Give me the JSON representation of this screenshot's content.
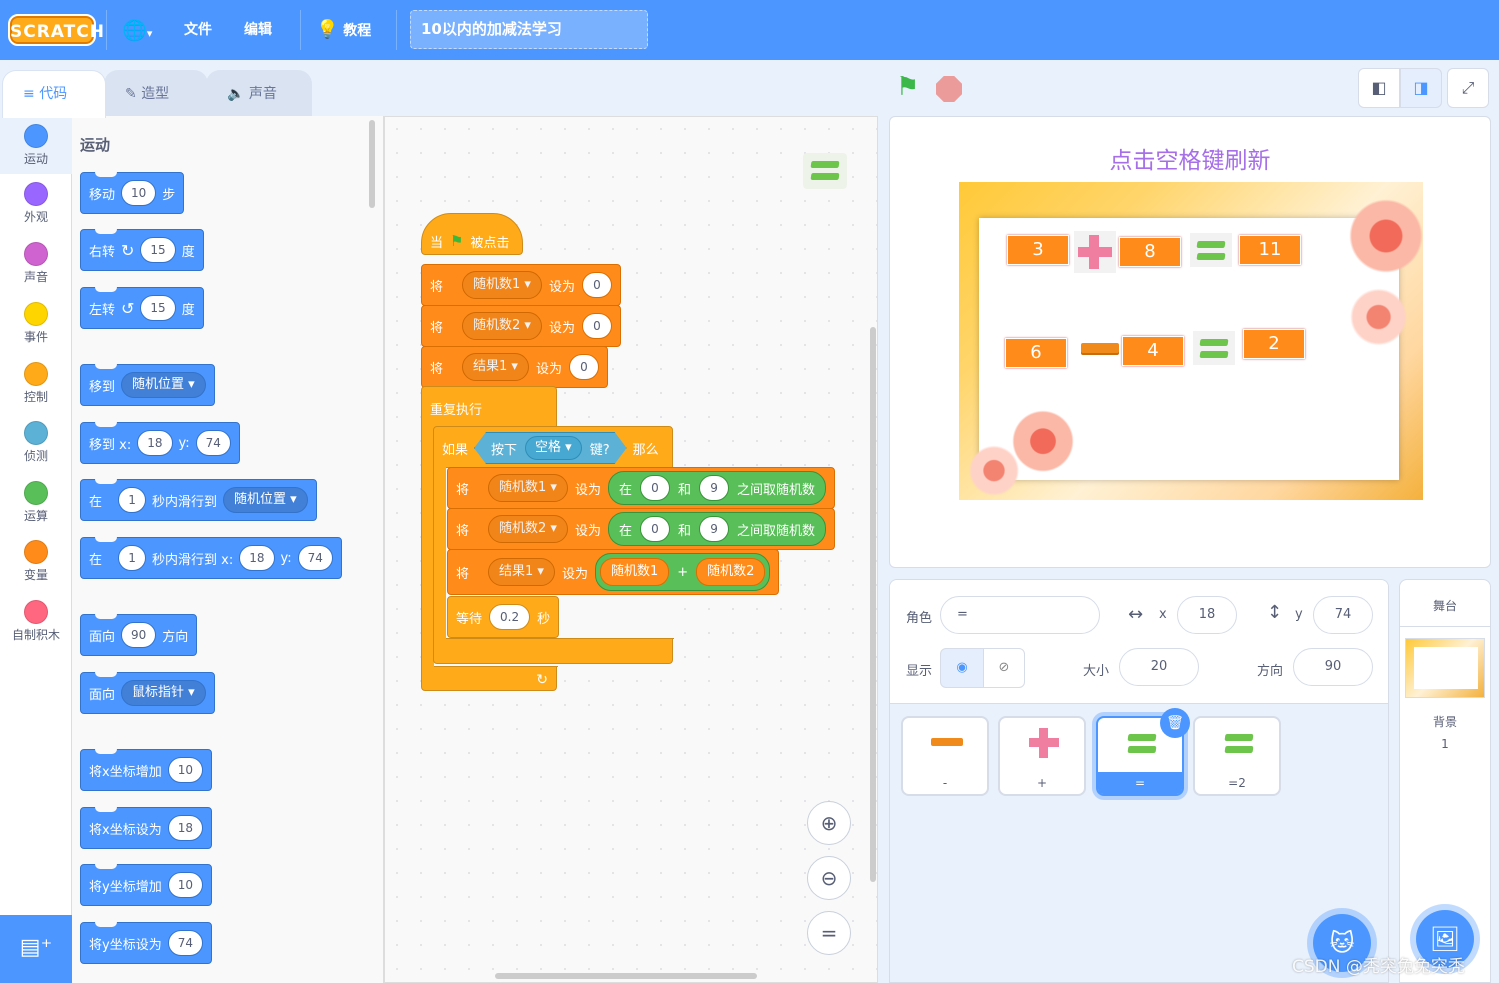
{
  "menubar": {
    "logo": "SCRATCH",
    "file": "文件",
    "edit": "编辑",
    "tutorials": "教程",
    "project_title": "10以内的加减法学习"
  },
  "tabs": [
    {
      "label": "代码"
    },
    {
      "label": "造型"
    },
    {
      "label": "声音"
    }
  ],
  "categories": [
    {
      "label": "运动",
      "color": "#4c97ff"
    },
    {
      "label": "外观",
      "color": "#9966ff"
    },
    {
      "label": "声音",
      "color": "#cf63cf"
    },
    {
      "label": "事件",
      "color": "#ffd500"
    },
    {
      "label": "控制",
      "color": "#ffab19"
    },
    {
      "label": "侦测",
      "color": "#5cb1d6"
    },
    {
      "label": "运算",
      "color": "#59c059"
    },
    {
      "label": "变量",
      "color": "#ff8c1a"
    },
    {
      "label": "自制积木",
      "color": "#ff6680"
    }
  ],
  "palette": {
    "title": "运动",
    "move": "移动",
    "move_steps": "10",
    "steps": "步",
    "turn_right": "右转",
    "turn_right_deg": "15",
    "deg": "度",
    "turn_left": "左转",
    "turn_left_deg": "15",
    "goto": "移到",
    "goto_target": "随机位置",
    "goto_xy": "移到 x:",
    "x_val": "18",
    "y_lbl": "y:",
    "y_val": "74",
    "glide": "在",
    "glide_secs": "1",
    "glide_to": "秒内滑行到",
    "glide_target": "随机位置",
    "glide_xy": "秒内滑行到 x:",
    "point_dir": "面向",
    "dir_val": "90",
    "dir_lbl": "方向",
    "point_towards": "面向",
    "towards_target": "鼠标指针",
    "change_x": "将x坐标增加",
    "change_x_val": "10",
    "set_x": "将x坐标设为",
    "set_x_val": "18",
    "change_y": "将y坐标增加",
    "change_y_val": "10",
    "set_y": "将y坐标设为",
    "set_y_val": "74"
  },
  "script": {
    "when": "当",
    "clicked": "被点击",
    "set": "将",
    "to": "设为",
    "var1": "随机数1",
    "var2": "随机数2",
    "var3": "结果1",
    "zero": "0",
    "forever": "重复执行",
    "if": "如果",
    "key_pressed": "按下",
    "key": "空格",
    "key_q": "键?",
    "then": "那么",
    "pick_in": "在",
    "and": "和",
    "nine": "9",
    "pick_between": "之间取随机数",
    "plus": "+",
    "wait": "等待",
    "wait_val": "0.2",
    "seconds": "秒"
  },
  "zoom": {
    "in": "+",
    "out": "−",
    "reset": "="
  },
  "stage": {
    "title": "点击空格键刷新",
    "row1": [
      "3",
      "8",
      "11"
    ],
    "row2": [
      "6",
      "4",
      "2"
    ]
  },
  "sprite_info": {
    "sprite_label": "角色",
    "sprite_name": "=",
    "x_label": "x",
    "x": "18",
    "y_label": "y",
    "y": "74",
    "show_label": "显示",
    "size_label": "大小",
    "size": "20",
    "direction_label": "方向",
    "direction": "90"
  },
  "sprites": [
    {
      "name": "-"
    },
    {
      "name": "+"
    },
    {
      "name": "="
    },
    {
      "name": "=2"
    }
  ],
  "stage_panel": {
    "title": "舞台",
    "backdrop_label": "背景",
    "backdrop_count": "1"
  },
  "watermark": "CSDN @秃突兔兔突秃"
}
